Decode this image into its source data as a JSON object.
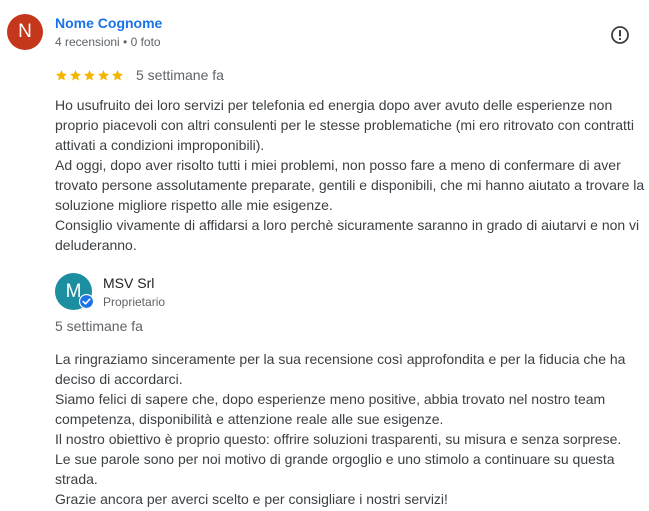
{
  "review": {
    "avatar_letter": "N",
    "reviewer_name": "Nome Cognome",
    "reviewer_meta": "4 recensioni • 0 foto",
    "rating": 5,
    "max_rating": 5,
    "date": "5 settimane fa",
    "paragraphs": [
      "Ho usufruito dei loro servizi per telefonia ed energia dopo aver avuto delle esperienze non proprio piacevoli con altri consulenti per le stesse problematiche (mi ero ritrovato con contratti attivati a condizioni improponibili).",
      "Ad oggi, dopo aver risolto tutti i miei problemi, non posso fare a meno di confermare di aver trovato persone assolutamente preparate, gentili e disponibili, che mi hanno aiutato a trovare la soluzione migliore rispetto alle mie esigenze.",
      "Consiglio vivamente di affidarsi a loro perchè sicuramente saranno in grado di aiutarvi e non vi deluderanno."
    ],
    "colors": {
      "avatar": "#c5371a",
      "name": "#1a73e8",
      "star": "#f4b400"
    }
  },
  "owner_reply": {
    "avatar_letter": "M",
    "owner_name": "MSV Srl",
    "owner_role": "Proprietario",
    "date": "5 settimane fa",
    "paragraphs": [
      "La ringraziamo sinceramente per la sua recensione così approfondita e per la fiducia che ha deciso di accordarci.",
      "Siamo felici di sapere che, dopo esperienze meno positive, abbia trovato nel nostro team competenza, disponibilità e attenzione reale alle sue esigenze.",
      "Il nostro obiettivo è proprio questo: offrire soluzioni trasparenti, su misura e senza sorprese.",
      "Le sue parole sono per noi motivo di grande orgoglio e uno stimolo a continuare su questa strada.",
      "Grazie ancora per averci scelto e per consigliare i nostri servizi!"
    ],
    "colors": {
      "avatar": "#1b8fa0",
      "badge": "#1a73e8"
    }
  },
  "icons": {
    "report": "report-flag-icon",
    "verified": "verified-check-icon",
    "star": "star-icon"
  }
}
